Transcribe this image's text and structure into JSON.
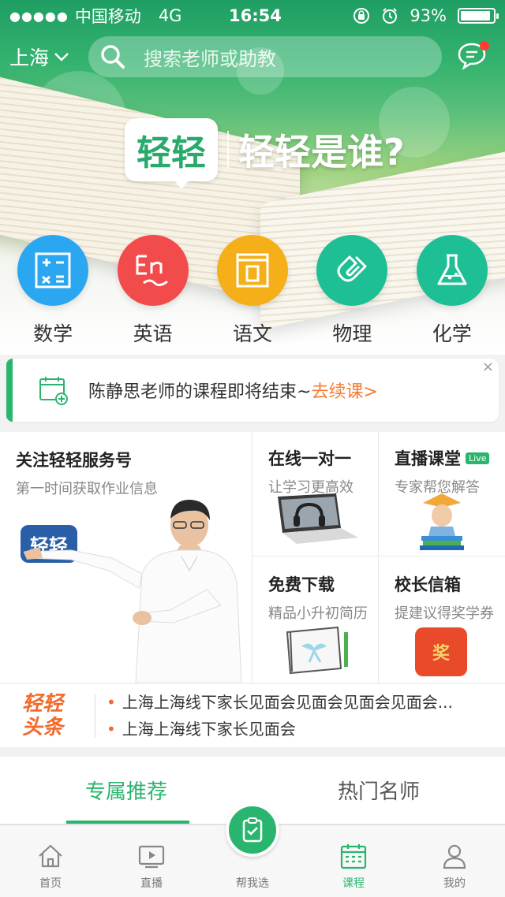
{
  "status": {
    "dots": "●●●●●",
    "carrier": "中国移动",
    "network": "4G",
    "time": "16:54",
    "battery": "93%",
    "battery_level": 0.93
  },
  "header": {
    "city": "上海",
    "search_placeholder": "搜索老师或助教"
  },
  "banner": {
    "logo": "轻轻",
    "tagline": "轻轻是谁?"
  },
  "subjects": [
    {
      "label": "数学",
      "icon": "calculator-icon",
      "color": "#2aa7f0"
    },
    {
      "label": "英语",
      "icon": "english-icon",
      "color": "#f24b4b"
    },
    {
      "label": "语文",
      "icon": "book-icon",
      "color": "#f5b019"
    },
    {
      "label": "物理",
      "icon": "magnet-icon",
      "color": "#1fbf95"
    },
    {
      "label": "化学",
      "icon": "flask-icon",
      "color": "#1fbf95"
    }
  ],
  "notice": {
    "text": "陈静思老师的课程即将结束~",
    "link": "去续课>",
    "close": "×"
  },
  "grid": {
    "follow": {
      "title": "关注轻轻服务号",
      "subtitle": "第一时间获取作业信息",
      "logo": "轻轻"
    },
    "online": {
      "title": "在线一对一",
      "subtitle": "让学习更高效"
    },
    "live": {
      "title": "直播课堂",
      "badge": "Live",
      "subtitle": "专家帮您解答"
    },
    "download": {
      "title": "免费下载",
      "subtitle": "精品小升初简历"
    },
    "mailbox": {
      "title": "校长信箱",
      "subtitle": "提建议得奖学券",
      "envelope_char": "奖"
    }
  },
  "headline": {
    "brand_line1": "轻轻",
    "brand_line2": "头条",
    "items": [
      "上海上海线下家长见面会见面会见面会见面会...",
      "上海上海线下家长见面会"
    ]
  },
  "tabs": [
    {
      "label": "专属推荐",
      "active": true
    },
    {
      "label": "热门名师",
      "active": false
    }
  ],
  "nav": [
    {
      "label": "首页",
      "icon": "home-icon"
    },
    {
      "label": "直播",
      "icon": "play-icon"
    },
    {
      "label": "帮我选",
      "icon": "checklist-icon"
    },
    {
      "label": "课程",
      "icon": "calendar-icon",
      "active": true
    },
    {
      "label": "我的",
      "icon": "user-icon"
    }
  ]
}
